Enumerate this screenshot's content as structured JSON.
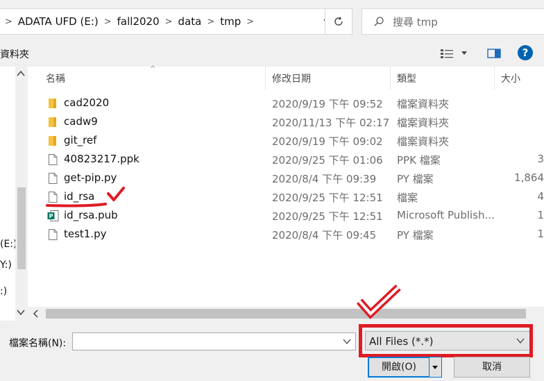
{
  "address_bar": {
    "crumbs": [
      "ADATA UFD (E:)",
      "fall2020",
      "data",
      "tmp"
    ]
  },
  "search": {
    "placeholder": "搜尋 tmp"
  },
  "toolbar": {
    "new_folder_label": "資料夾"
  },
  "nav_pane": {
    "items": [
      "(E:)",
      "Y:)",
      ":)"
    ]
  },
  "columns": {
    "name": "名稱",
    "date": "修改日期",
    "type": "類型",
    "size": "大小"
  },
  "files": [
    {
      "name": "cad2020",
      "date": "2020/9/19 下午 09:52",
      "type": "檔案資料夾",
      "size": "",
      "icon": "folder-icon"
    },
    {
      "name": "cadw9",
      "date": "2020/11/13 下午 02:17",
      "type": "檔案資料夾",
      "size": "",
      "icon": "folder-icon"
    },
    {
      "name": "git_ref",
      "date": "2020/9/19 下午 09:02",
      "type": "檔案資料夾",
      "size": "",
      "icon": "folder-icon"
    },
    {
      "name": "40823217.ppk",
      "date": "2020/9/25 下午 01:06",
      "type": "PPK 檔案",
      "size": "3",
      "icon": "file-icon"
    },
    {
      "name": "get-pip.py",
      "date": "2020/8/4 下午 09:39",
      "type": "PY 檔案",
      "size": "1,864",
      "icon": "file-icon"
    },
    {
      "name": "id_rsa",
      "date": "2020/9/25 下午 12:51",
      "type": "檔案",
      "size": "4",
      "icon": "file-icon"
    },
    {
      "name": "id_rsa.pub",
      "date": "2020/9/25 下午 12:51",
      "type": "Microsoft Publish...",
      "size": "1",
      "icon": "publisher-icon"
    },
    {
      "name": "test1.py",
      "date": "2020/8/4 下午 09:45",
      "type": "PY 檔案",
      "size": "1",
      "icon": "file-icon"
    }
  ],
  "bottom": {
    "filename_label": "檔案名稱(N):",
    "filename_value": "",
    "filetype_selected": "All Files (*.*)",
    "open_label": "開啟(O)",
    "cancel_label": "取消"
  },
  "colors": {
    "annotation_red": "#e01b24",
    "accent": "#0078d7",
    "folder": "#f5c242"
  }
}
